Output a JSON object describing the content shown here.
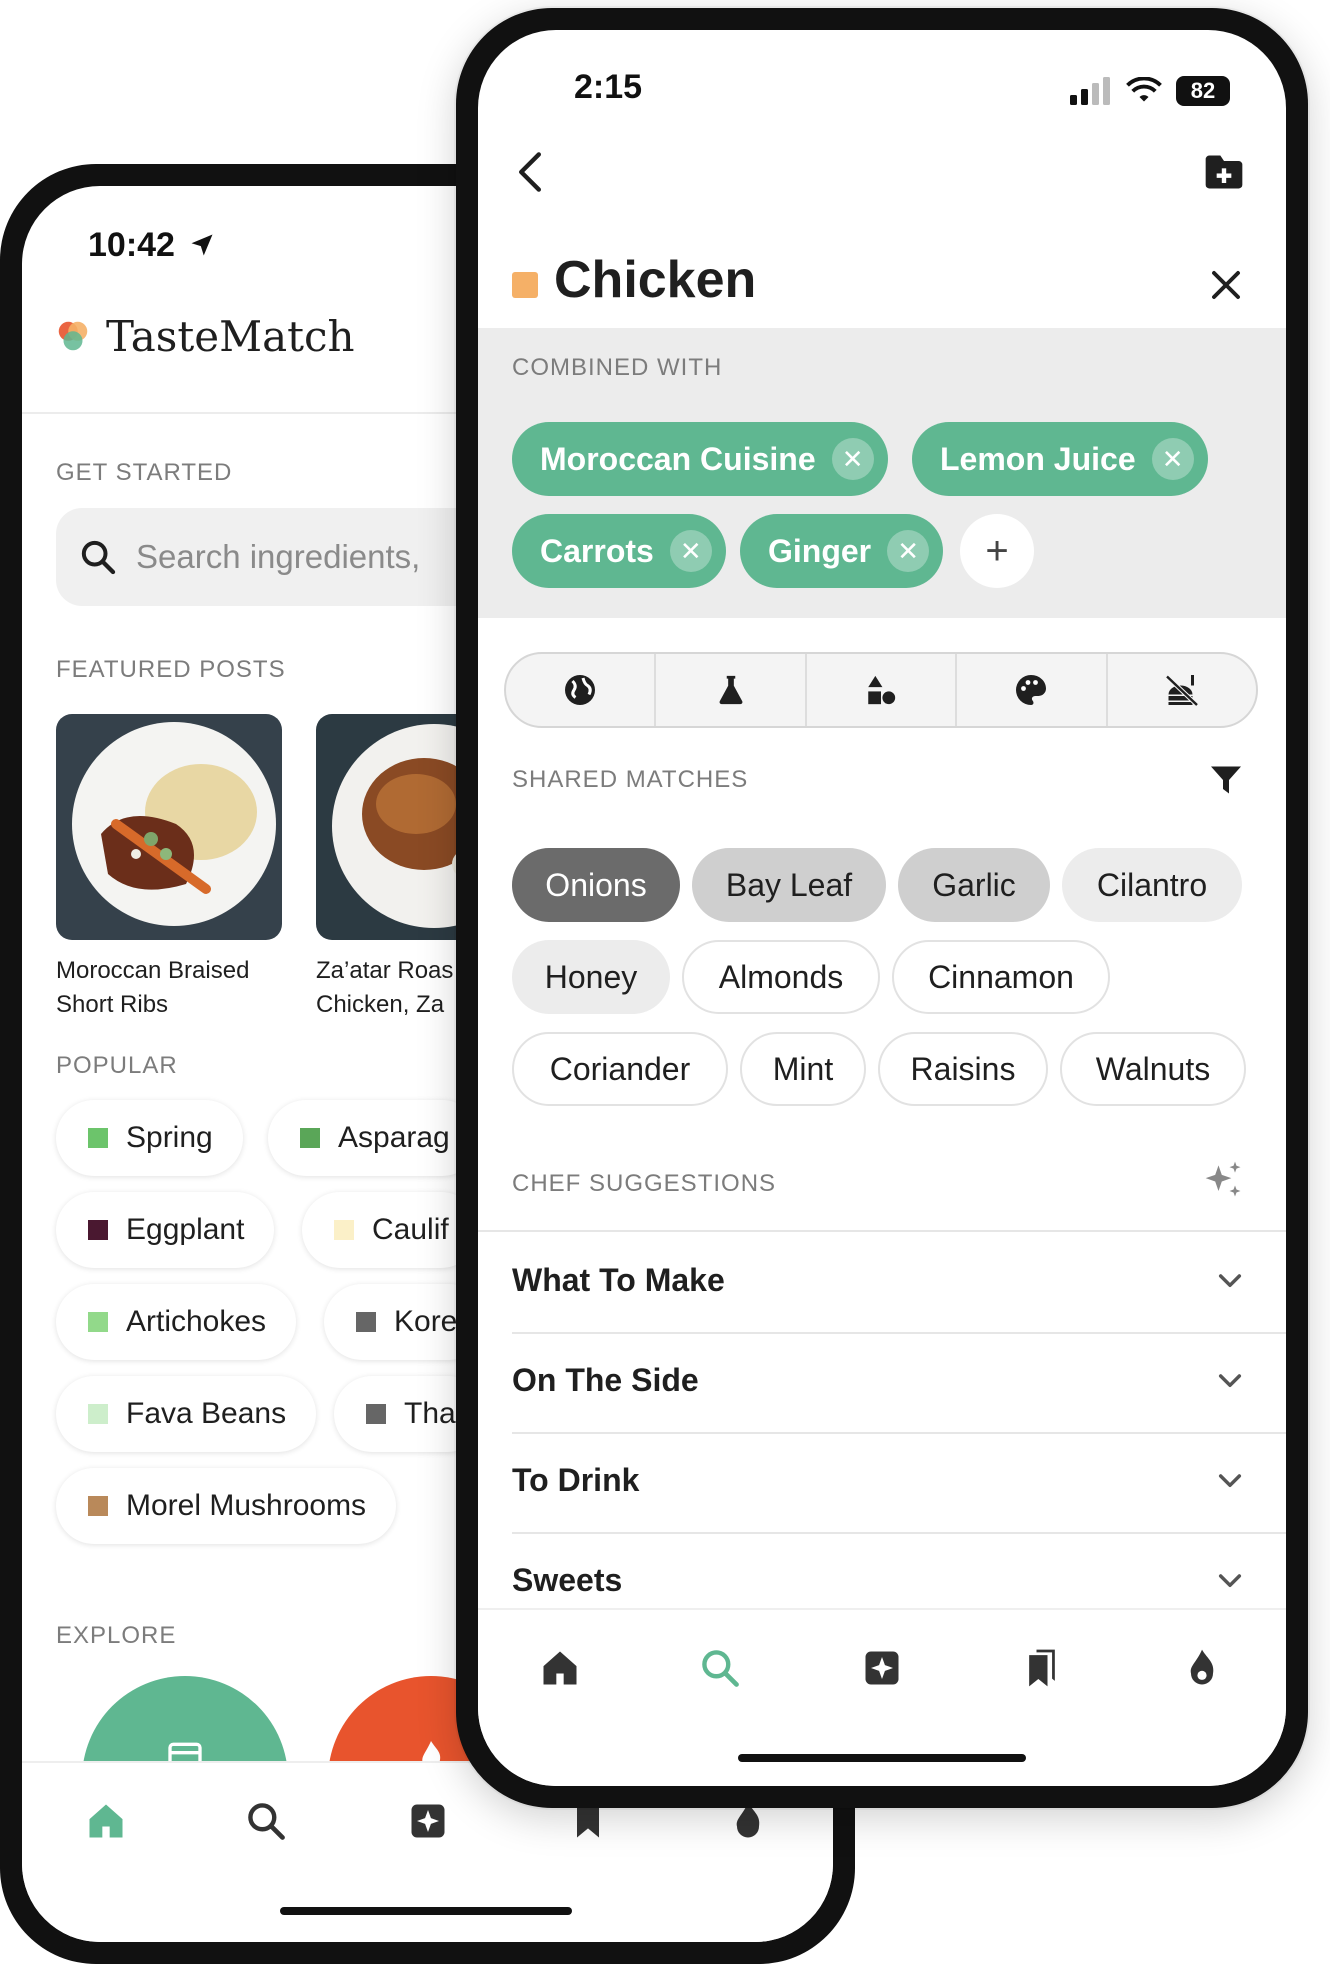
{
  "back": {
    "time": "10:42",
    "app_name": "TasteMatch",
    "get_started_label": "GET STARTED",
    "search_placeholder": "Search ingredients,",
    "featured_label": "FEATURED POSTS",
    "posts": [
      {
        "title": "Moroccan Braised Short Ribs"
      },
      {
        "title": "Za’atar Roas Chicken, Za"
      }
    ],
    "popular_label": "POPULAR",
    "popular": [
      {
        "label": "Spring",
        "color": "#6cc46b"
      },
      {
        "label": "Asparag",
        "color": "#5aa658"
      },
      {
        "label": "Eggplant",
        "color": "#4a1830"
      },
      {
        "label": "Caulif",
        "color": "#fbf0c8"
      },
      {
        "label": "Artichokes",
        "color": "#92d98a"
      },
      {
        "label": "Kore",
        "color": "#666666"
      },
      {
        "label": "Fava Beans",
        "color": "#cdeecb"
      },
      {
        "label": "Tha",
        "color": "#666666"
      },
      {
        "label": "Morel Mushrooms",
        "color": "#b9895a"
      }
    ],
    "explore_label": "EXPLORE",
    "explore_colors": [
      "#5fb791",
      "#e8542d"
    ],
    "accent": "#5fb791"
  },
  "front": {
    "time": "2:15",
    "battery": "82",
    "title": "Chicken",
    "title_swatch": "#f5b067",
    "combined_label": "COMBINED WITH",
    "combined": [
      "Moroccan Cuisine",
      "Lemon Juice",
      "Carrots",
      "Ginger"
    ],
    "add_symbol": "+",
    "shared_label": "SHARED MATCHES",
    "matches": [
      {
        "label": "Onions",
        "strength": "strong"
      },
      {
        "label": "Bay Leaf",
        "strength": "mid"
      },
      {
        "label": "Garlic",
        "strength": "mid"
      },
      {
        "label": "Cilantro",
        "strength": "light"
      },
      {
        "label": "Honey",
        "strength": "light"
      },
      {
        "label": "Almonds",
        "strength": "outline"
      },
      {
        "label": "Cinnamon",
        "strength": "outline"
      },
      {
        "label": "Coriander",
        "strength": "outline"
      },
      {
        "label": "Mint",
        "strength": "outline"
      },
      {
        "label": "Raisins",
        "strength": "outline"
      },
      {
        "label": "Walnuts",
        "strength": "outline"
      }
    ],
    "chef_label": "CHEF SUGGESTIONS",
    "sections": [
      "What To Make",
      "On The Side",
      "To Drink",
      "Sweets"
    ],
    "accent": "#5fb791"
  }
}
